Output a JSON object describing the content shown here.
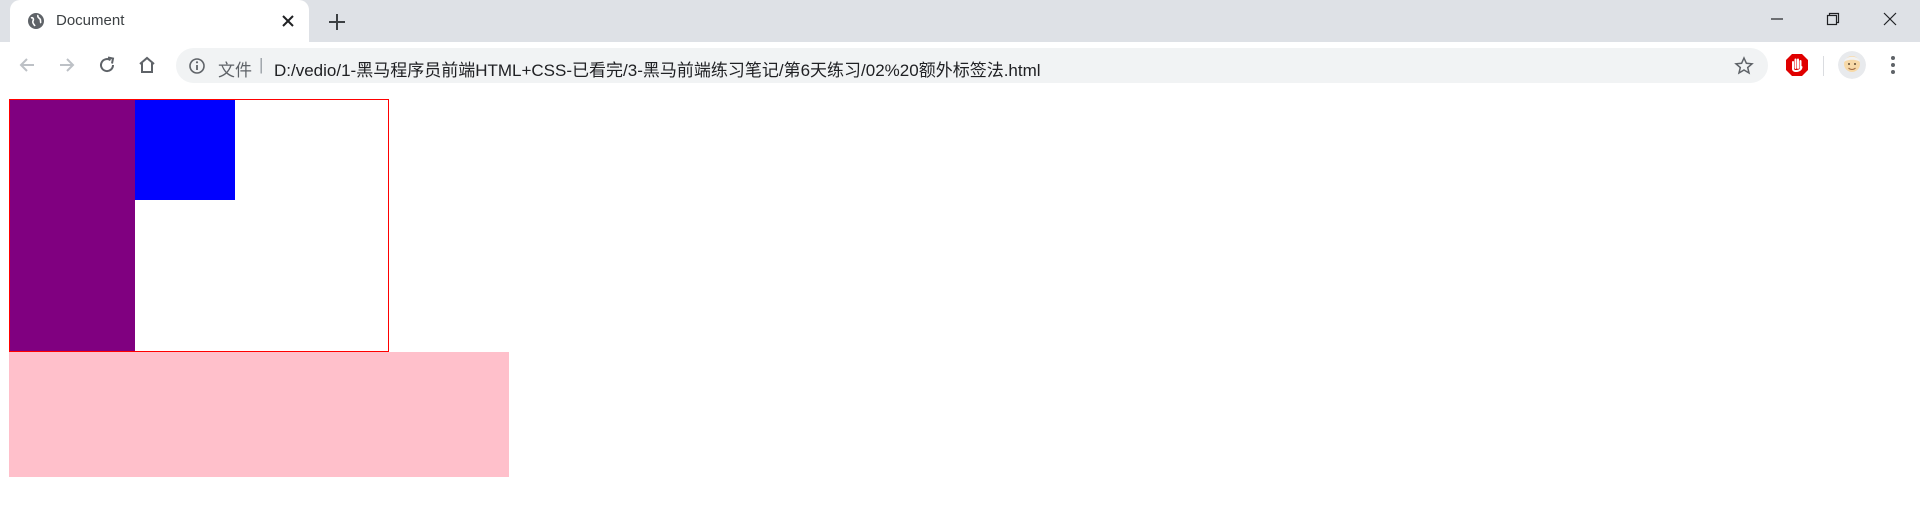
{
  "browser": {
    "tab": {
      "title": "Document",
      "favicon_icon": "globe-icon",
      "close_icon": "close-icon"
    },
    "new_tab_icon": "plus-icon",
    "window_controls": {
      "minimize_icon": "minimize-icon",
      "maximize_icon": "restore-icon",
      "close_icon": "close-icon"
    },
    "toolbar": {
      "back_icon": "arrow-left-icon",
      "forward_icon": "arrow-right-icon",
      "reload_icon": "reload-icon",
      "home_icon": "home-icon"
    },
    "omnibox": {
      "info_icon": "info-icon",
      "scheme_label": "文件",
      "separator": "|",
      "url": "D:/vedio/1-黑马程序员前端HTML+CSS-已看完/3-黑马前端练习笔记/第6天练习/02%20额外标签法.html",
      "star_icon": "star-icon"
    },
    "extensions": {
      "adblock_icon": "adblock-icon",
      "avatar_icon": "avatar-icon",
      "menu_icon": "kebab-menu-icon"
    }
  },
  "page": {
    "outer_box": {
      "border_color": "#ff0000"
    },
    "purple_box": {
      "color": "#800080"
    },
    "blue_box": {
      "color": "#0000ff"
    },
    "pink_box": {
      "color": "#ffc0cb"
    }
  }
}
